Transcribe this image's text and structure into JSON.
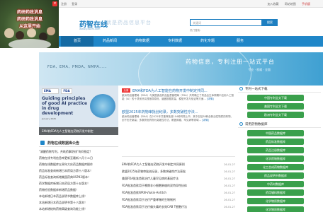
{
  "topbar": {
    "left": [
      "注册",
      "登录"
    ],
    "right": [
      "加入收藏",
      "网站地图",
      "手机版"
    ]
  },
  "header": {
    "logo": "药智在线",
    "logo_sub": "www.yaozhi.com",
    "slogan": "就是药品信息平台",
    "search_placeholder": "关键词",
    "search_button": "搜索",
    "hot_label": "热门搜索："
  },
  "promo": {
    "lines": [
      "药研药政消息",
      "药研药政消息",
      "从这里开始"
    ],
    "close": "×"
  },
  "nav": [
    {
      "label": "首页",
      "active": true
    },
    {
      "label": "药品新闻",
      "active": false
    },
    {
      "label": "药物数据",
      "active": false
    },
    {
      "label": "专利数据",
      "active": false
    },
    {
      "label": "药化专题",
      "active": false
    },
    {
      "label": "服务",
      "active": false
    }
  ],
  "banner": {
    "left_text": "FDA、EMA、PMDA、NMPA……",
    "right_title": "药物信息，专利注册一站式平台",
    "right_sub": "专业 · 权威 · 全面"
  },
  "slide": {
    "ema": "EMA",
    "fda": "FDA",
    "title": "Guiding principles of good AI practice in drug development",
    "date": "January 2026",
    "caption": "EMA和FDA为人工智能在药物开发中制定"
  },
  "announcements": {
    "title": "药物在线数据库公告",
    "items": [
      "\"清醒药物专利，共筑药事防线\"询问指定!",
      "药物在线专利信息库更新至最新八月十二日",
      "药物在线数据库五周年大庆药品数据库操作",
      "药品标准查询新增日本药局方第十八版本！",
      "药品标准查询新增美国药典USP43版本！",
      "药学数据库新增日本药局方第十五版本！",
      "药物检验数据库新增药品数据！",
      "本站新增日本药品说明书数据库上线！",
      "本站新增日本药品说明书第十八版本！",
      "本站新增结构药物高级查询功能上线！"
    ]
  },
  "featured": [
    {
      "tag": "头条",
      "title": "EMA和FDA为人工智能在药物开发中制定共同...",
      "desc": "欧洲药品管理局（EMA）与美国食品药品监督管理局（FDA）共同确立了药品全生命周期中应用人工智能（AI）的十项良好实践指导原则，涵盖数据质量、模型开发与验证等方面...",
      "link": "[详情]"
    },
    {
      "tag": "",
      "title": "欧盟2025年药物审批创纪录，多数突破性疗法...",
      "desc": "欧洲药品管理局（EMA）在2025年共推荐批准104种药物上市，其中包括38种含新活性物质的药物，创下历史新高；多数获批药物为突破性疗法，覆盖肿瘤、罕见病等领域...",
      "link": "[详情]"
    }
  ],
  "news": [
    {
      "title": "EMA和FDA为人工智能在药物开发中制定共同原则",
      "date": "26-01-27"
    },
    {
      "title": "欧盟2025年药物审批创纪录，多数突破性疗法获批",
      "date": "26-01-27"
    },
    {
      "title": "美国FDA批准首款治疗儿童罕见病的基因疗法",
      "date": "26-01-27"
    },
    {
      "title": "FDA批准首款用于晚期非小细胞肺癌的双特异性抗体",
      "date": "26-01-27"
    },
    {
      "title": "FDA批准首款WRN-Vlukin-Antitch",
      "date": "26-01-27"
    },
    {
      "title": "FDA批准首款用于治疗严重哮喘的生物制剂",
      "date": "26-01-27"
    },
    {
      "title": "FDA批准首款用于治疗偏头痛的长效CAB T细胞疗法",
      "date": "26-01-27"
    }
  ],
  "sidebar": {
    "patent_head": "专利一站式下载",
    "patent_buttons": [
      "中国专利全文下载",
      "美国专利全文下载",
      "欧洲专利全文下载"
    ],
    "db_head": "常用药物数据库",
    "db_buttons": [
      "中国药品数据库",
      "药品标准数据库",
      "药品注册数据库",
      "化学药物数据库",
      "化工合成药物数据库",
      "药品说明书数据库",
      "中药材数据库",
      "药用辅料数据库",
      "化学物质数据库",
      "化学物质数据库"
    ]
  },
  "colors": {
    "brand": "#1f86c8",
    "accent_green": "#3aa04c",
    "tag_red": "#e33333"
  }
}
